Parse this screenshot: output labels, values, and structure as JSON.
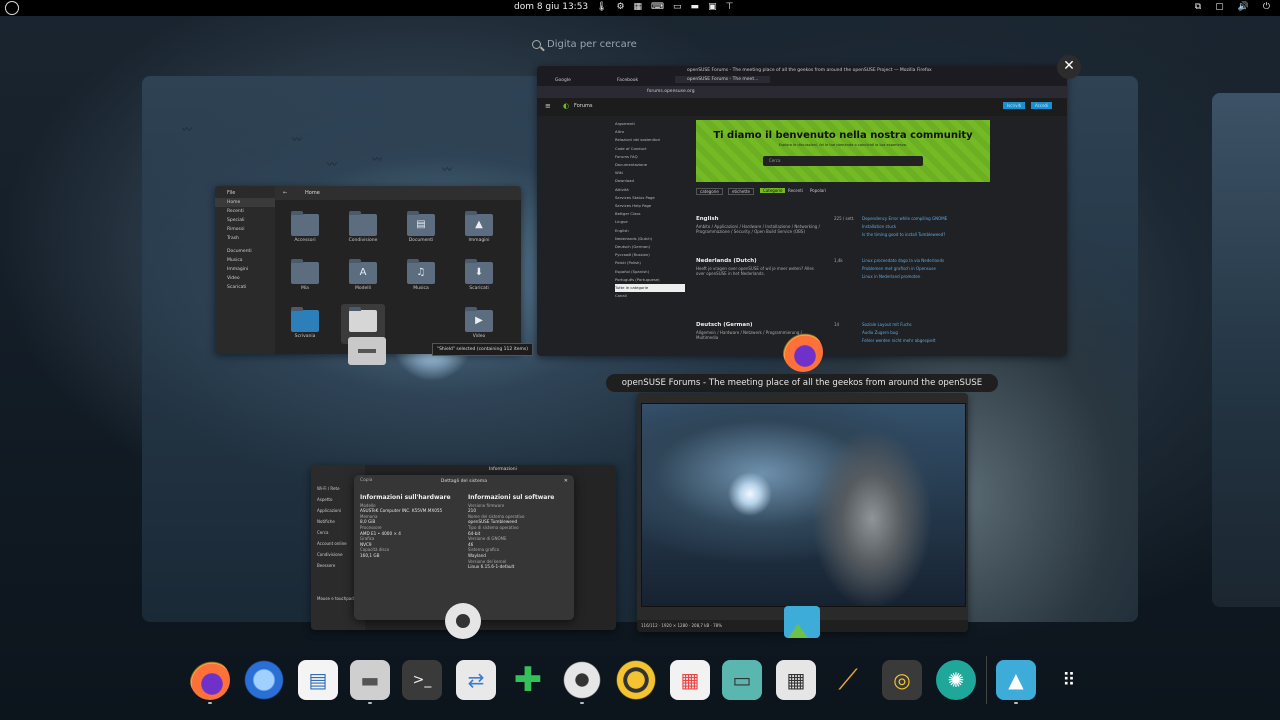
{
  "topbar": {
    "clock": "dom 8 giu  13:53"
  },
  "search": {
    "placeholder": "Digita per cercare"
  },
  "files": {
    "title": "File",
    "path": "Home",
    "sidebar": [
      "Home",
      "Recenti",
      "Speciali",
      "Rimossi",
      "Trash",
      "Documenti",
      "Musica",
      "Immagini",
      "Video",
      "Scaricati"
    ],
    "folders": [
      {
        "name": "Accessori",
        "glyph": ""
      },
      {
        "name": "Condivisione",
        "glyph": ""
      },
      {
        "name": "Documenti",
        "glyph": "▤"
      },
      {
        "name": "Immagini",
        "glyph": "▲"
      },
      {
        "name": "Mia",
        "glyph": ""
      },
      {
        "name": "Modelli",
        "glyph": "A"
      },
      {
        "name": "Musica",
        "glyph": "♫"
      },
      {
        "name": "Scaricati",
        "glyph": "⬇"
      },
      {
        "name": "Scrivania",
        "glyph": ""
      },
      {
        "name": "",
        "glyph": ""
      },
      {
        "name": "Video",
        "glyph": "▶"
      }
    ],
    "tooltip": "\"Shield\" selected (containing 112 items)"
  },
  "firefox": {
    "window_title": "openSUSE Forums - The meeting place of all the geekos from around the openSUSE Project — Mozilla Firefox",
    "tabs": [
      "Google",
      "Facebook",
      "openSUSE Forums - The meet..."
    ],
    "url": "forums.opensuse.org",
    "brand": "Forums",
    "login_buttons": [
      "Iscriviti",
      "Accedi"
    ],
    "banner_title": "Ti diamo il benvenuto nella nostra community",
    "banner_sub": "Esplora le discussioni, fai le tue domande o condividi la tua esperienza.",
    "banner_search": "Cerca",
    "side_nav": [
      "Argomenti",
      "Altro",
      "Relazioni dei sostenitori",
      "Code of Conduct",
      "Forums FAQ",
      "Documentazione",
      "Wiki",
      "Download",
      "Attività",
      "Services Status Page",
      "Services Help Page",
      "Bettger Class",
      "Lingue",
      "English",
      "Nederlands (Dutch)",
      "Deutsch (German)",
      "Русский (Russian)",
      "Polski (Polish)",
      "Español (Spanish)",
      "Português (Portuguese)",
      "Tutte le categorie",
      "Canali"
    ],
    "cat_tabs": [
      "categorie",
      "etichette",
      "Categorie",
      "Recenti",
      "Popolari"
    ],
    "categories": [
      {
        "name": "English",
        "desc": "Ambito / Applicazioni / Hardware / Installazione / Networking / Programmazione / Security / Open Build Service (OBS)",
        "count": "225 / sett."
      },
      {
        "name": "Nederlands (Dutch)",
        "desc": "Heeft je vragen over openSUSE of wil je meer weten? Alles over openSUSE in het Nederlands.",
        "count": "1,4k"
      },
      {
        "name": "Deutsch (German)",
        "desc": "Allgemein / Hardware / Netzwerk / Programmierung / Multimedia",
        "count": "14"
      }
    ],
    "recent_topics": [
      "Dependency Error while compiling GNOME",
      "Installation stuck",
      "Is the timing good to install Tumbleweed?",
      "Linux proceedato dago la via Nederlands",
      "Problemen met grafisch in Opensuse",
      "Linux in Nederland promoten",
      "Soziale Layout mit Fuchs",
      "Audio Zugern bug",
      "Fehler werden nicht mehr abgespielt"
    ]
  },
  "hover_title": "openSUSE Forums - The meeting place of all the geekos from around the openSUSE Project — Mozilla Firefox",
  "image_viewer": {
    "status": "116/112  ·  1920 × 1280  ·  208,7 kB   ·   78%"
  },
  "settings": {
    "title": "Impostazioni",
    "panel_title": "Informazioni",
    "sidebar": [
      "Wi-Fi / Rete",
      "Aspetto",
      "Applicazioni",
      "Notifiche",
      "Cerca",
      "Account online",
      "Condivisione",
      "Beessere",
      "Mouse e touchpad"
    ],
    "dialog": {
      "title": "Dettagli del sistema",
      "copy_label": "Copia",
      "hardware_title": "Informazioni sull'hardware",
      "software_title": "Informazioni sul software",
      "hardware": [
        {
          "label": "Modello",
          "value": "ASUSTeK Computer INC. K55VM.MX055"
        },
        {
          "label": "Memoria",
          "value": "8,0 GiB"
        },
        {
          "label": "Processore",
          "value": "AMD E1 • 4000 × 4"
        },
        {
          "label": "Grafica",
          "value": "NVC9"
        },
        {
          "label": "Capacità disco",
          "value": "160,1 GB"
        }
      ],
      "software": [
        {
          "label": "Versione firmware",
          "value": "210"
        },
        {
          "label": "Nome del sistema operativo",
          "value": "openSUSE Tumbleweed"
        },
        {
          "label": "Tipo di sistema operativo",
          "value": "64-bit"
        },
        {
          "label": "Versione di GNOME",
          "value": "46"
        },
        {
          "label": "Sistema grafico",
          "value": "Wayland"
        },
        {
          "label": "Versione del kernel",
          "value": "Linux 6.15.6-1-default"
        }
      ]
    }
  },
  "dash": {
    "apps": [
      {
        "name": "firefox",
        "color": "#ff7139"
      },
      {
        "name": "thunderbird",
        "color": "#2a6fd6"
      },
      {
        "name": "writer",
        "color": "#2f6db8"
      },
      {
        "name": "files",
        "color": "#cfcfcf"
      },
      {
        "name": "terminal",
        "color": "#3a3a3a"
      },
      {
        "name": "tweaks",
        "color": "#e9e9e9"
      },
      {
        "name": "extensions",
        "color": "#35c15a"
      },
      {
        "name": "settings",
        "color": "#e6e6e6"
      },
      {
        "name": "rhythmbox",
        "color": "#f4c430"
      },
      {
        "name": "software",
        "color": "#f2f2f2"
      },
      {
        "name": "scanner",
        "color": "#59b7b0"
      },
      {
        "name": "calculator",
        "color": "#e6e6e6"
      },
      {
        "name": "cleaner",
        "color": "#e8a33c"
      },
      {
        "name": "speaker",
        "color": "#3a3a3a"
      },
      {
        "name": "aperture",
        "color": "#1fa79a"
      },
      {
        "name": "image-viewer",
        "color": "#3dacd9"
      },
      {
        "name": "show-apps",
        "color": "#ffffff"
      }
    ]
  }
}
